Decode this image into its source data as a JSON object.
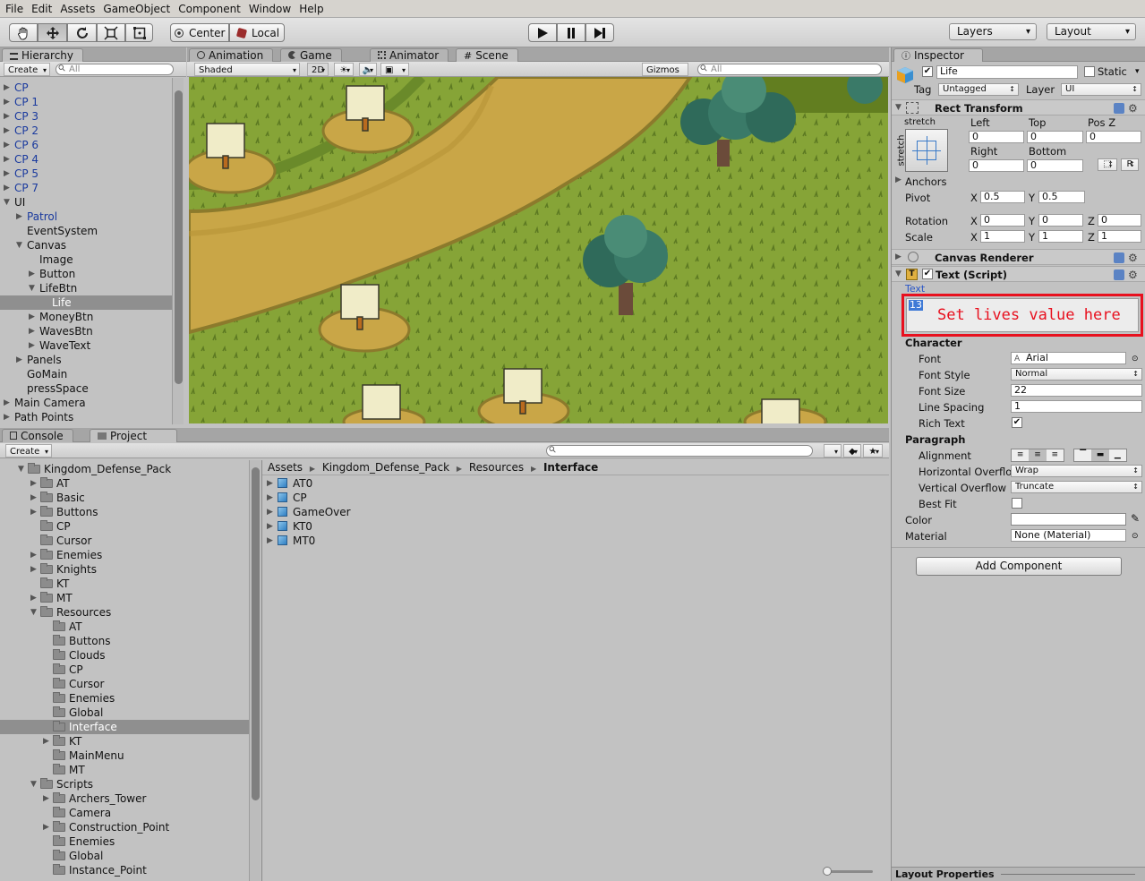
{
  "menu": [
    "File",
    "Edit",
    "Assets",
    "GameObject",
    "Component",
    "Window",
    "Help"
  ],
  "toolbar": {
    "pivot_label": "Center",
    "space_label": "Local",
    "layers_label": "Layers",
    "layout_label": "Layout"
  },
  "hierarchy": {
    "tab": "Hierarchy",
    "create": "Create",
    "search_placeholder": "All",
    "items": [
      {
        "label": "CP",
        "indent": 0,
        "arrow": "right",
        "blue": true
      },
      {
        "label": "CP 1",
        "indent": 0,
        "arrow": "right",
        "blue": true
      },
      {
        "label": "CP 3",
        "indent": 0,
        "arrow": "right",
        "blue": true
      },
      {
        "label": "CP 2",
        "indent": 0,
        "arrow": "right",
        "blue": true
      },
      {
        "label": "CP 6",
        "indent": 0,
        "arrow": "right",
        "blue": true
      },
      {
        "label": "CP 4",
        "indent": 0,
        "arrow": "right",
        "blue": true
      },
      {
        "label": "CP 5",
        "indent": 0,
        "arrow": "right",
        "blue": true
      },
      {
        "label": "CP 7",
        "indent": 0,
        "arrow": "right",
        "blue": true
      },
      {
        "label": "UI",
        "indent": 0,
        "arrow": "down",
        "blue": false
      },
      {
        "label": "Patrol",
        "indent": 1,
        "arrow": "right",
        "blue": true
      },
      {
        "label": "EventSystem",
        "indent": 1,
        "arrow": "",
        "blue": false
      },
      {
        "label": "Canvas",
        "indent": 1,
        "arrow": "down",
        "blue": false
      },
      {
        "label": "Image",
        "indent": 2,
        "arrow": "",
        "blue": false
      },
      {
        "label": "Button",
        "indent": 2,
        "arrow": "right",
        "blue": false
      },
      {
        "label": "LifeBtn",
        "indent": 2,
        "arrow": "down",
        "blue": false
      },
      {
        "label": "Life",
        "indent": 3,
        "arrow": "",
        "blue": false,
        "selected": true
      },
      {
        "label": "MoneyBtn",
        "indent": 2,
        "arrow": "right",
        "blue": false
      },
      {
        "label": "WavesBtn",
        "indent": 2,
        "arrow": "right",
        "blue": false
      },
      {
        "label": "WaveText",
        "indent": 2,
        "arrow": "right",
        "blue": false
      },
      {
        "label": "Panels",
        "indent": 1,
        "arrow": "right",
        "blue": false
      },
      {
        "label": "GoMain",
        "indent": 1,
        "arrow": "",
        "blue": false
      },
      {
        "label": "pressSpace",
        "indent": 1,
        "arrow": "",
        "blue": false
      },
      {
        "label": "Main Camera",
        "indent": 0,
        "arrow": "right",
        "blue": false
      },
      {
        "label": "Path Points",
        "indent": 0,
        "arrow": "right",
        "blue": false
      }
    ]
  },
  "scene": {
    "tabs": [
      "Animation",
      "Game",
      "Animator",
      "Scene"
    ],
    "shading": "Shaded",
    "mode_2d": "2D",
    "gizmos": "Gizmos",
    "search_placeholder": "All"
  },
  "project": {
    "tabs": [
      "Console",
      "Project"
    ],
    "create": "Create",
    "tree": [
      {
        "label": "Kingdom_Defense_Pack",
        "indent": 0,
        "arrow": "down"
      },
      {
        "label": "AT",
        "indent": 1,
        "arrow": "right"
      },
      {
        "label": "Basic",
        "indent": 1,
        "arrow": "right"
      },
      {
        "label": "Buttons",
        "indent": 1,
        "arrow": "right"
      },
      {
        "label": "CP",
        "indent": 1,
        "arrow": ""
      },
      {
        "label": "Cursor",
        "indent": 1,
        "arrow": ""
      },
      {
        "label": "Enemies",
        "indent": 1,
        "arrow": "right"
      },
      {
        "label": "Knights",
        "indent": 1,
        "arrow": "right"
      },
      {
        "label": "KT",
        "indent": 1,
        "arrow": ""
      },
      {
        "label": "MT",
        "indent": 1,
        "arrow": "right"
      },
      {
        "label": "Resources",
        "indent": 1,
        "arrow": "down"
      },
      {
        "label": "AT",
        "indent": 2,
        "arrow": ""
      },
      {
        "label": "Buttons",
        "indent": 2,
        "arrow": ""
      },
      {
        "label": "Clouds",
        "indent": 2,
        "arrow": ""
      },
      {
        "label": "CP",
        "indent": 2,
        "arrow": ""
      },
      {
        "label": "Cursor",
        "indent": 2,
        "arrow": ""
      },
      {
        "label": "Enemies",
        "indent": 2,
        "arrow": ""
      },
      {
        "label": "Global",
        "indent": 2,
        "arrow": ""
      },
      {
        "label": "Interface",
        "indent": 2,
        "arrow": "",
        "selected": true
      },
      {
        "label": "KT",
        "indent": 2,
        "arrow": "right"
      },
      {
        "label": "MainMenu",
        "indent": 2,
        "arrow": ""
      },
      {
        "label": "MT",
        "indent": 2,
        "arrow": ""
      },
      {
        "label": "Scripts",
        "indent": 1,
        "arrow": "down"
      },
      {
        "label": "Archers_Tower",
        "indent": 2,
        "arrow": "right"
      },
      {
        "label": "Camera",
        "indent": 2,
        "arrow": ""
      },
      {
        "label": "Construction_Point",
        "indent": 2,
        "arrow": "right"
      },
      {
        "label": "Enemies",
        "indent": 2,
        "arrow": ""
      },
      {
        "label": "Global",
        "indent": 2,
        "arrow": ""
      },
      {
        "label": "Instance_Point",
        "indent": 2,
        "arrow": ""
      }
    ],
    "breadcrumb": [
      "Assets",
      "Kingdom_Defense_Pack",
      "Resources",
      "Interface"
    ],
    "assets": [
      "AT0",
      "CP",
      "GameOver",
      "KT0",
      "MT0"
    ]
  },
  "inspector": {
    "tab": "Inspector",
    "object_name": "Life",
    "static_label": "Static",
    "tag_label": "Tag",
    "tag_value": "Untagged",
    "layer_label": "Layer",
    "layer_value": "UI",
    "rect": {
      "title": "Rect Transform",
      "stretch": "stretch",
      "left_label": "Left",
      "top_label": "Top",
      "posz_label": "Pos Z",
      "right_label": "Right",
      "bottom_label": "Bottom",
      "left": "0",
      "top": "0",
      "posz": "0",
      "right": "0",
      "bottom": "0",
      "r_button": "R",
      "anchors": "Anchors",
      "pivot": "Pivot",
      "pivot_x": "0.5",
      "pivot_y": "0.5",
      "rotation": "Rotation",
      "rot_x": "0",
      "rot_y": "0",
      "rot_z": "0",
      "scale": "Scale",
      "scale_x": "1",
      "scale_y": "1",
      "scale_z": "1",
      "axis_x": "X",
      "axis_y": "Y",
      "axis_z": "Z"
    },
    "canvas_renderer": "Canvas Renderer",
    "text_script": {
      "title": "Text (Script)",
      "text_label": "Text",
      "text_value": "13",
      "annotation": "Set lives value here",
      "character": "Character",
      "font_label": "Font",
      "font_value": "Arial",
      "font_style_label": "Font Style",
      "font_style_value": "Normal",
      "font_size_label": "Font Size",
      "font_size_value": "22",
      "line_spacing_label": "Line Spacing",
      "line_spacing_value": "1",
      "rich_text_label": "Rich Text",
      "paragraph": "Paragraph",
      "alignment_label": "Alignment",
      "h_overflow_label": "Horizontal Overflo",
      "h_overflow_value": "Wrap",
      "v_overflow_label": "Vertical Overflow",
      "v_overflow_value": "Truncate",
      "best_fit_label": "Best Fit",
      "color_label": "Color",
      "material_label": "Material",
      "material_value": "None (Material)"
    },
    "add_component": "Add Component",
    "layout_properties": "Layout Properties"
  },
  "colors": {
    "annotation_red": "#e8101e",
    "selection": "#8f8f8f",
    "scene_grass": "#86a437",
    "scene_path": "#c9a647"
  }
}
